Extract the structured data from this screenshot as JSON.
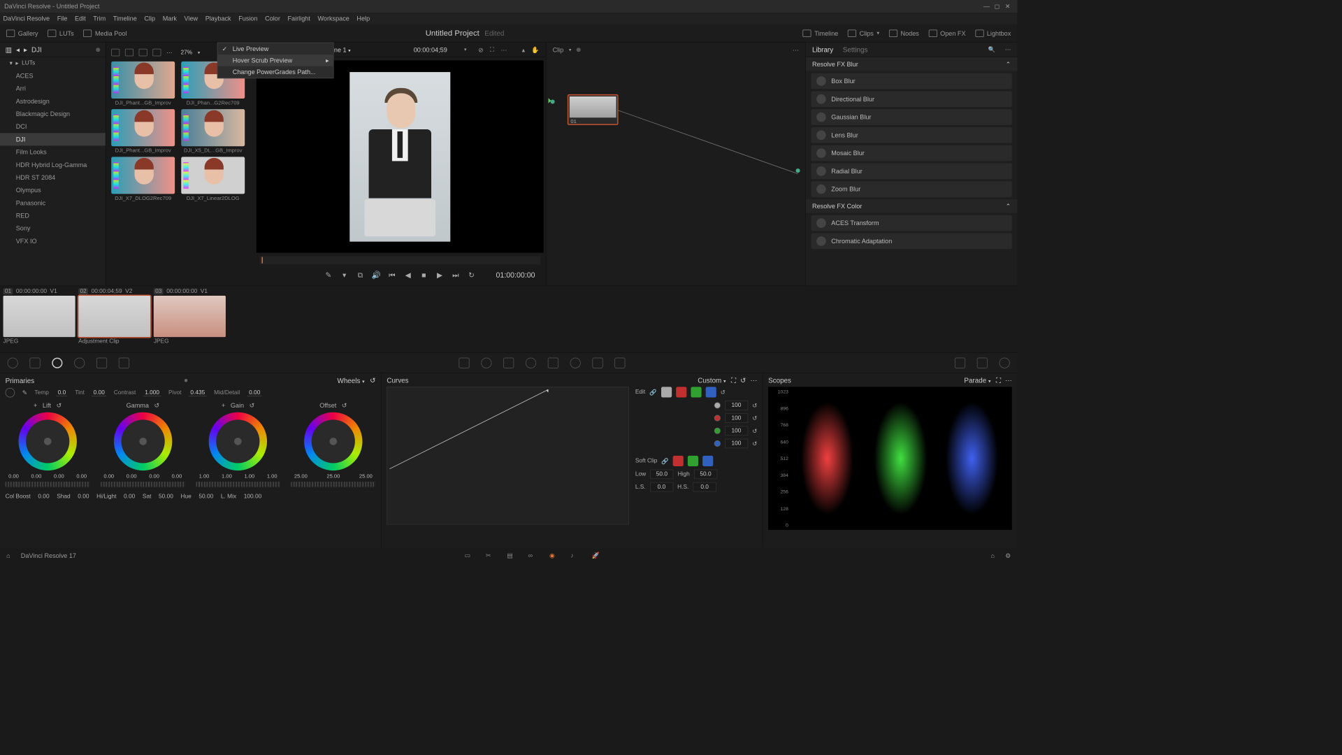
{
  "window_title": "DaVinci Resolve - Untitled Project",
  "menu": [
    "DaVinci Resolve",
    "File",
    "Edit",
    "Trim",
    "Timeline",
    "Clip",
    "Mark",
    "View",
    "Playback",
    "Fusion",
    "Color",
    "Fairlight",
    "Workspace",
    "Help"
  ],
  "topstrip": {
    "gallery": "Gallery",
    "luts": "LUTs",
    "mediapool": "Media Pool",
    "project": "Untitled Project",
    "edited": "Edited",
    "timeline": "Timeline",
    "clips": "Clips",
    "nodes": "Nodes",
    "openfx": "Open FX",
    "lightbox": "Lightbox"
  },
  "luts": {
    "heading": "DJI",
    "root": "LUTs",
    "folders": [
      "ACES",
      "Arri",
      "Astrodesign",
      "Blackmagic Design",
      "DCI",
      "DJI",
      "Film Looks",
      "HDR Hybrid Log-Gamma",
      "HDR ST 2084",
      "Olympus",
      "Panasonic",
      "RED",
      "Sony",
      "VFX IO"
    ],
    "selected": "DJI",
    "zoom": "27%",
    "thumbs": [
      {
        "label": "DJI_Phant...GB_Improv"
      },
      {
        "label": "DJI_Phan...G2Rec709"
      },
      {
        "label": "DJI_Phant...GB_Improv"
      },
      {
        "label": "DJI_X5_DL...GB_Improv"
      },
      {
        "label": "DJI_X7_DLOG2Rec709"
      },
      {
        "label": "DJI_X7_Linear2DLOG"
      }
    ]
  },
  "ctx": {
    "live_preview": "Live Preview",
    "hover_scrub": "Hover Scrub Preview",
    "change_path": "Change PowerGrades Path..."
  },
  "viewer": {
    "timeline_name": "Timeline 1",
    "timeline_tc": "00:00:04;59",
    "player_tc": "01:00:00:00"
  },
  "nodes": {
    "label": "Clip",
    "node_label": "01"
  },
  "library": {
    "tabs": {
      "library": "Library",
      "settings": "Settings"
    },
    "section1": "Resolve FX Blur",
    "blur_fx": [
      "Box Blur",
      "Directional Blur",
      "Gaussian Blur",
      "Lens Blur",
      "Mosaic Blur",
      "Radial Blur",
      "Zoom Blur"
    ],
    "section2": "Resolve FX Color",
    "color_fx": [
      "ACES Transform",
      "Chromatic Adaptation"
    ]
  },
  "clips": [
    {
      "num": "01",
      "tc": "00:00:00:00",
      "track": "V1",
      "type": "JPEG"
    },
    {
      "num": "02",
      "tc": "00:00:04;59",
      "track": "V2",
      "type": "Adjustment Clip"
    },
    {
      "num": "03",
      "tc": "00:00:00:00",
      "track": "V1",
      "type": "JPEG"
    }
  ],
  "primaries": {
    "title": "Primaries",
    "mode": "Wheels",
    "params": {
      "temp_l": "Temp",
      "temp": "0.0",
      "tint_l": "Tint",
      "tint": "0.00",
      "contrast_l": "Contrast",
      "contrast": "1.000",
      "pivot_l": "Pivot",
      "pivot": "0.435",
      "middet_l": "Mid/Detail",
      "middet": "0.00"
    },
    "wheels": [
      {
        "name": "Lift",
        "vals": [
          "0.00",
          "0.00",
          "0.00",
          "0.00"
        ]
      },
      {
        "name": "Gamma",
        "vals": [
          "0.00",
          "0.00",
          "0.00",
          "0.00"
        ]
      },
      {
        "name": "Gain",
        "vals": [
          "1.00",
          "1.00",
          "1.00",
          "1.00"
        ]
      },
      {
        "name": "Offset",
        "vals": [
          "25.00",
          "25.00",
          "25.00"
        ]
      }
    ],
    "bottom": {
      "colboost_l": "Col Boost",
      "colboost": "0.00",
      "shad_l": "Shad",
      "shad": "0.00",
      "hilight_l": "Hi/Light",
      "hilight": "0.00",
      "sat_l": "Sat",
      "sat": "50.00",
      "hue_l": "Hue",
      "hue": "50.00",
      "lmix_l": "L. Mix",
      "lmix": "100.00"
    }
  },
  "curves": {
    "title": "Curves",
    "mode": "Custom",
    "edit": "Edit",
    "softclip": "Soft Clip",
    "ch_val": "100",
    "low_l": "Low",
    "low": "50.0",
    "high_l": "High",
    "high": "50.0",
    "ls_l": "L.S.",
    "ls": "0.0",
    "hs_l": "H.S.",
    "hs": "0.0"
  },
  "scopes": {
    "title": "Scopes",
    "mode": "Parade",
    "ticks": [
      "1023",
      "896",
      "768",
      "640",
      "512",
      "384",
      "256",
      "128",
      "0"
    ]
  },
  "footer": "DaVinci Resolve 17"
}
